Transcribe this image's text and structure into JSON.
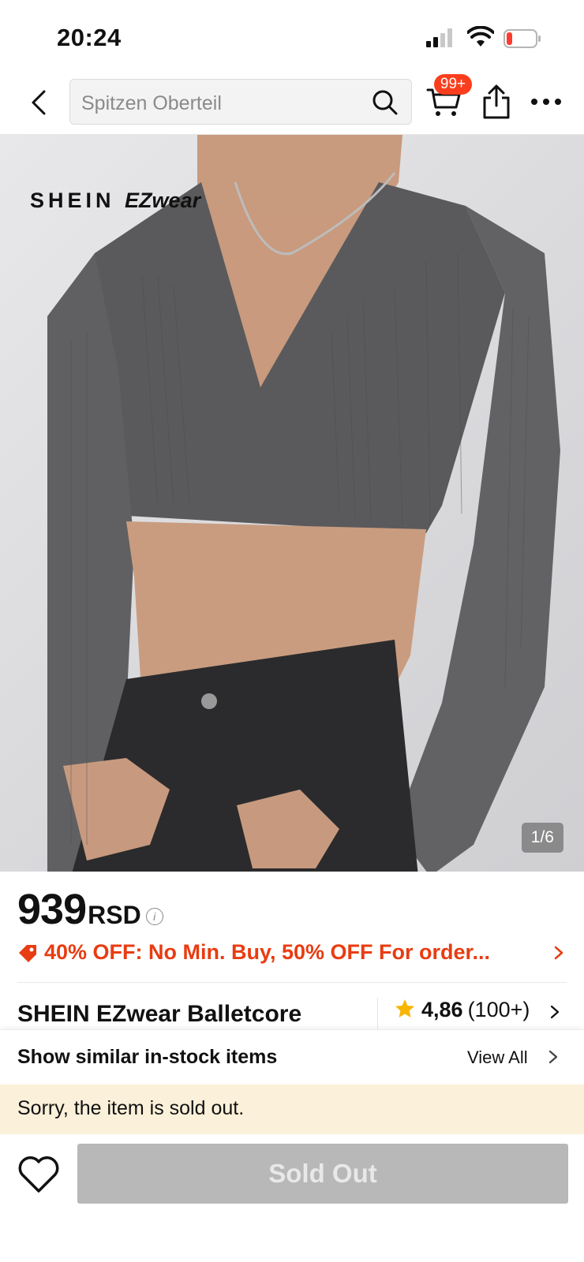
{
  "status_bar": {
    "time": "20:24"
  },
  "nav": {
    "search_placeholder": "Spitzen Oberteil",
    "cart_badge": "99+"
  },
  "product_image": {
    "brand_watermark_main": "SHEIN",
    "brand_watermark_sub": "EZwear",
    "counter": "1/6"
  },
  "price": {
    "amount": "939",
    "currency": "RSD"
  },
  "promo": {
    "text": "40% OFF: No Min. Buy,  50% OFF For order..."
  },
  "product": {
    "title": "SHEIN EZwear Balletcore",
    "rating": "4,86",
    "rating_count": "(100+)"
  },
  "similar": {
    "title": "Show similar in-stock items",
    "view_all": "View All"
  },
  "notice": {
    "sold_out_message": "Sorry, the item is sold out."
  },
  "actions": {
    "sold_out_label": "Sold Out"
  },
  "colors": {
    "accent_red": "#fa3e1d",
    "promo_red": "#e83c12",
    "star_yellow": "#f7b500",
    "notice_bg": "#fbf0d9",
    "disabled_button": "#b8b8b8"
  }
}
